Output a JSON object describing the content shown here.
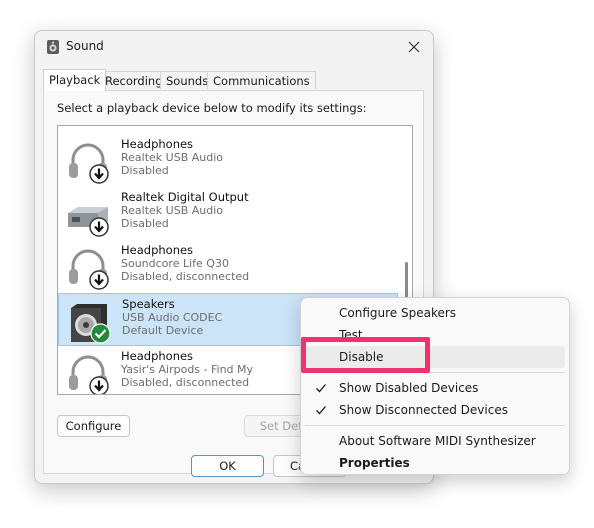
{
  "window": {
    "title": "Sound",
    "title_icon": "speaker-icon",
    "close_icon": "close-icon"
  },
  "tabs": [
    {
      "label": "Playback",
      "active": true
    },
    {
      "label": "Recording",
      "active": false
    },
    {
      "label": "Sounds",
      "active": false
    },
    {
      "label": "Communications",
      "active": false
    }
  ],
  "instruction": "Select a playback device below to modify its settings:",
  "devices": [
    {
      "name": "Headphones",
      "sub": "Realtek USB Audio",
      "status": "Disabled",
      "icon": "headphones-icon",
      "badge": "down-arrow-icon",
      "selected": false
    },
    {
      "name": "Realtek Digital Output",
      "sub": "Realtek USB Audio",
      "status": "Disabled",
      "icon": "digital-output-icon",
      "badge": "down-arrow-icon",
      "selected": false
    },
    {
      "name": "Headphones",
      "sub": "Soundcore Life Q30",
      "status": "Disabled, disconnected",
      "icon": "headphones-icon",
      "badge": "down-arrow-icon",
      "selected": false
    },
    {
      "name": "Speakers",
      "sub": "USB Audio CODEC",
      "status": "Default Device",
      "icon": "speaker-icon",
      "badge": "check-icon",
      "selected": true
    },
    {
      "name": "Headphones",
      "sub": "Yasir's Airpods - Find My",
      "status": "Disabled, disconnected",
      "icon": "headphones-icon",
      "badge": "down-arrow-icon",
      "selected": false
    }
  ],
  "buttons": {
    "configure": "Configure",
    "set_default": "Set Default",
    "ok": "OK",
    "cancel": "Cancel"
  },
  "context_menu": {
    "items": [
      {
        "label": "Configure Speakers",
        "checked": false,
        "bold": false,
        "hover": false
      },
      {
        "label": "Test",
        "checked": false,
        "bold": false,
        "hover": false
      },
      {
        "label": "Disable",
        "checked": false,
        "bold": false,
        "hover": true
      },
      {
        "label": "Show Disabled Devices",
        "checked": true,
        "bold": false,
        "hover": false
      },
      {
        "label": "Show Disconnected Devices",
        "checked": true,
        "bold": false,
        "hover": false
      },
      {
        "label": "About Software MIDI Synthesizer",
        "checked": false,
        "bold": false,
        "hover": false
      },
      {
        "label": "Properties",
        "checked": false,
        "bold": true,
        "hover": false
      }
    ]
  },
  "colors": {
    "highlight": "#f0336e",
    "selection": "#cce4f7",
    "accent": "#1e8a3a"
  }
}
